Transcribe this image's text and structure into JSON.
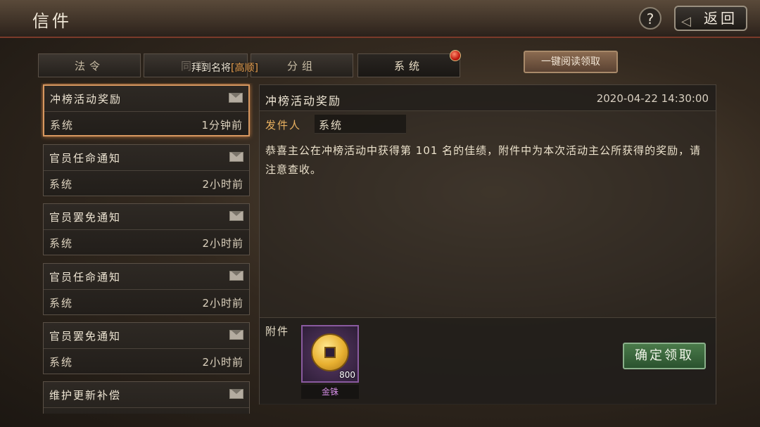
{
  "header": {
    "title": "信件",
    "help_label": "?",
    "back_label": "返回"
  },
  "tabs": [
    {
      "label": "法令"
    },
    {
      "label": "同盟"
    },
    {
      "label": "分组"
    },
    {
      "label": "系统"
    }
  ],
  "ticker": {
    "prefix": "拜到名将",
    "highlight": "[高顺]"
  },
  "read_all_label": "一键阅读领取",
  "mail_list": [
    {
      "title": "冲榜活动奖励",
      "sender": "系统",
      "time": "1分钟前"
    },
    {
      "title": "官员任命通知",
      "sender": "系统",
      "time": "2小时前"
    },
    {
      "title": "官员罢免通知",
      "sender": "系统",
      "time": "2小时前"
    },
    {
      "title": "官员任命通知",
      "sender": "系统",
      "time": "2小时前"
    },
    {
      "title": "官员罢免通知",
      "sender": "系统",
      "time": "2小时前"
    },
    {
      "title": "维护更新补偿",
      "sender": "",
      "time": ""
    }
  ],
  "detail": {
    "title": "冲榜活动奖励",
    "date": "2020-04-22 14:30:00",
    "sender_label": "发件人",
    "sender_value": "系统",
    "body": "恭喜主公在冲榜活动中获得第 101 名的佳绩，附件中为本次活动主公所获得的奖励，请注意查收。",
    "attachment_label": "附件",
    "attachment": {
      "name": "金铢",
      "count": "800",
      "icon": "gold-coin-icon"
    },
    "confirm_label": "确定领取"
  }
}
